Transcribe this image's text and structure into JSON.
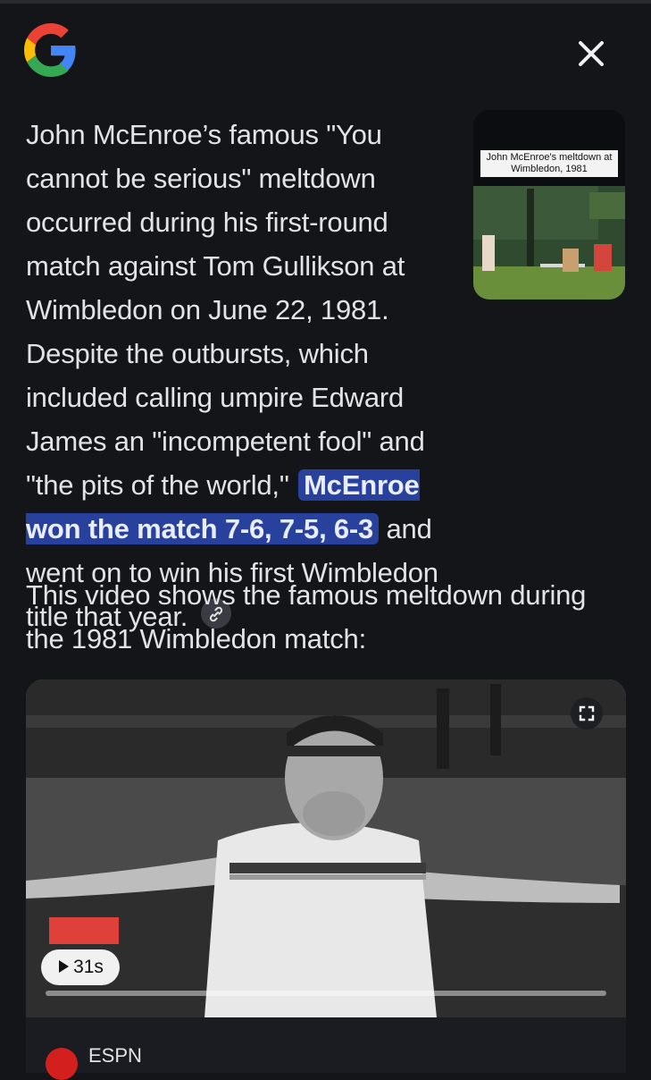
{
  "header": {
    "logo_icon": "google-g-icon",
    "close_icon": "close-icon",
    "colors": {
      "blue": "#4285F4",
      "red": "#EA4335",
      "yellow": "#FBBC05",
      "green": "#34A853"
    }
  },
  "answer": {
    "thumbnail": {
      "caption": "John McEnroe's meltdown at Wimbledon, 1981"
    },
    "para_before": "John McEnroe’s famous \"You cannot be serious\" meltdown occurred during his first-round match against Tom Gullikson at Wimbledon on June 22, 1981. Despite the outbursts, which included calling umpire Edward James an \"incompetent fool\" and \"the pits of the world,\"",
    "highlight": "McEnroe won the match 7-6, 7-5, 6-3",
    "para_after": "and went on to win his first Wimbledon title that year.",
    "link_icon": "link-icon",
    "highlight_color": "#27419d"
  },
  "video_intro": "This video shows the famous meltdown during the 1981 Wimbledon match:",
  "video": {
    "duration": "31s",
    "play_icon": "play-icon",
    "expand_icon": "expand-icon",
    "progress": 0.0
  },
  "source": {
    "name": "ESPN",
    "brand_color": "#d3201f"
  }
}
